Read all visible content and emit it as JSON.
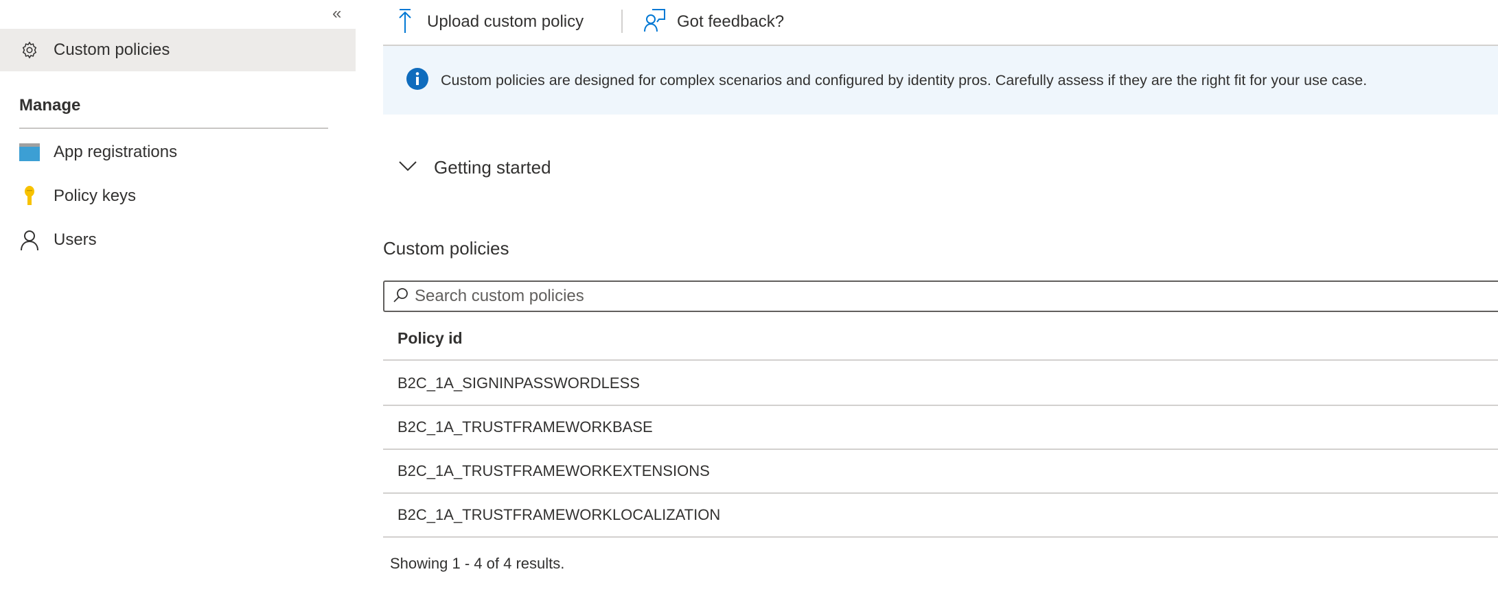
{
  "sidebar": {
    "collapse_icon": "double-chevron-left-icon",
    "items": [
      {
        "label": "Custom policies",
        "icon": "gear-icon",
        "selected": true
      },
      {
        "label": "App registrations",
        "icon": "app-registrations-icon"
      },
      {
        "label": "Policy keys",
        "icon": "key-icon"
      },
      {
        "label": "Users",
        "icon": "user-icon"
      }
    ],
    "section_label": "Manage"
  },
  "toolbar": {
    "upload_label": "Upload custom policy",
    "feedback_label": "Got feedback?"
  },
  "banner": {
    "text": "Custom policies are designed for complex scenarios and configured by identity pros. Carefully assess if they are the right fit for your use case."
  },
  "getting_started": {
    "label": "Getting started"
  },
  "policies": {
    "heading": "Custom policies",
    "search_placeholder": "Search custom policies",
    "column_header": "Policy id",
    "rows": [
      "B2C_1A_SIGNINPASSWORDLESS",
      "B2C_1A_TRUSTFRAMEWORKBASE",
      "B2C_1A_TRUSTFRAMEWORKEXTENSIONS",
      "B2C_1A_TRUSTFRAMEWORKLOCALIZATION"
    ],
    "footer": "Showing 1 - 4 of 4 results."
  },
  "colors": {
    "accent": "#0078d4",
    "banner_bg": "#eff6fc",
    "selected_bg": "#edebe9"
  }
}
